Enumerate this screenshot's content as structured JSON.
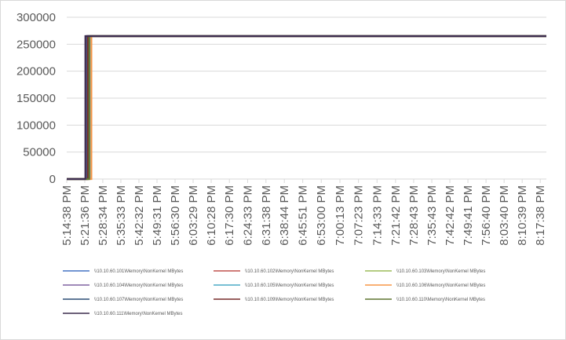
{
  "chart_data": {
    "type": "line",
    "title": "",
    "xlabel": "",
    "ylabel": "",
    "ylim": [
      0,
      300000
    ],
    "yticks": [
      0,
      50000,
      100000,
      150000,
      200000,
      250000,
      300000
    ],
    "ytick_labels": [
      "0",
      "50000",
      "100000",
      "150000",
      "200000",
      "250000",
      "300000"
    ],
    "grid": "horizontal",
    "legend_position": "bottom",
    "x_tick_labels": [
      "5:14:38 PM",
      "5:21:36 PM",
      "5:28:34 PM",
      "5:35:33 PM",
      "5:42:32 PM",
      "5:49:31 PM",
      "5:56:30 PM",
      "6:03:29 PM",
      "6:10:28 PM",
      "6:17:30 PM",
      "6:24:33 PM",
      "6:31:38 PM",
      "6:38:44 PM",
      "6:45:51 PM",
      "6:53:00 PM",
      "7:00:13 PM",
      "7:07:23 PM",
      "7:14:33 PM",
      "7:21:42 PM",
      "7:28:43 PM",
      "7:35:43 PM",
      "7:42:42 PM",
      "7:49:41 PM",
      "7:56:40 PM",
      "8:03:40 PM",
      "8:10:39 PM",
      "8:17:38 PM"
    ],
    "x_start": "5:14:38 PM",
    "x_end": "8:20:00 PM",
    "series": [
      {
        "name": "\\\\10.10.60.101\\Memory\\NonKernel MBytes",
        "color": "#4472c4",
        "x": [
          "5:14:38 PM",
          "5:21:36 PM",
          "5:22:10 PM",
          "5:22:10 PM",
          "8:20:00 PM"
        ],
        "y": [
          0,
          0,
          0,
          265000,
          265000
        ]
      },
      {
        "name": "\\\\10.10.60.102\\Memory\\NonKernel MBytes",
        "color": "#c0504d",
        "x": [
          "5:14:38 PM",
          "5:21:36 PM",
          "5:22:30 PM",
          "5:22:30 PM",
          "8:20:00 PM"
        ],
        "y": [
          0,
          0,
          0,
          265000,
          265000
        ]
      },
      {
        "name": "\\\\10.10.60.103\\Memory\\NonKernel MBytes",
        "color": "#9bbb59",
        "x": [
          "5:14:38 PM",
          "5:21:36 PM",
          "5:23:00 PM",
          "5:23:00 PM",
          "8:20:00 PM"
        ],
        "y": [
          0,
          0,
          0,
          265000,
          265000
        ]
      },
      {
        "name": "\\\\10.10.60.104\\Memory\\NonKernel MBytes",
        "color": "#8064a2",
        "x": [
          "5:14:38 PM",
          "5:21:36 PM",
          "5:22:20 PM",
          "5:22:20 PM",
          "8:20:00 PM"
        ],
        "y": [
          0,
          0,
          0,
          265000,
          265000
        ]
      },
      {
        "name": "\\\\10.10.60.105\\Memory\\NonKernel MBytes",
        "color": "#4bacc6",
        "x": [
          "5:14:38 PM",
          "5:21:36 PM",
          "5:23:30 PM",
          "5:23:30 PM",
          "8:20:00 PM"
        ],
        "y": [
          0,
          0,
          0,
          265000,
          265000
        ]
      },
      {
        "name": "\\\\10.10.60.106\\Memory\\NonKernel MBytes",
        "color": "#f79646",
        "x": [
          "5:14:38 PM",
          "5:21:36 PM",
          "5:24:10 PM",
          "5:24:10 PM",
          "8:20:00 PM"
        ],
        "y": [
          0,
          0,
          0,
          265000,
          265000
        ]
      },
      {
        "name": "\\\\10.10.60.107\\Memory\\NonKernel MBytes",
        "color": "#2c4d75",
        "x": [
          "5:14:38 PM",
          "5:21:36 PM",
          "5:22:40 PM",
          "5:22:40 PM",
          "8:20:00 PM"
        ],
        "y": [
          0,
          0,
          0,
          265000,
          265000
        ]
      },
      {
        "name": "\\\\10.10.60.109\\Memory\\NonKernel MBytes",
        "color": "#772c2a",
        "x": [
          "5:14:38 PM",
          "5:21:36 PM",
          "5:22:50 PM",
          "5:22:50 PM",
          "8:20:00 PM"
        ],
        "y": [
          0,
          0,
          0,
          265000,
          265000
        ]
      },
      {
        "name": "\\\\10.10.60.110\\Memory\\NonKernel MBytes",
        "color": "#5f7530",
        "x": [
          "5:14:38 PM",
          "5:21:36 PM",
          "5:23:20 PM",
          "5:23:20 PM",
          "8:20:00 PM"
        ],
        "y": [
          0,
          0,
          0,
          265000,
          265000
        ]
      },
      {
        "name": "\\\\10.10.60.111\\Memory\\NonKernel MBytes",
        "color": "#3d2d4f",
        "x": [
          "5:14:38 PM",
          "5:21:36 PM",
          "5:21:50 PM",
          "5:21:50 PM",
          "8:20:00 PM"
        ],
        "y": [
          0,
          0,
          0,
          265000,
          265000
        ]
      }
    ]
  }
}
